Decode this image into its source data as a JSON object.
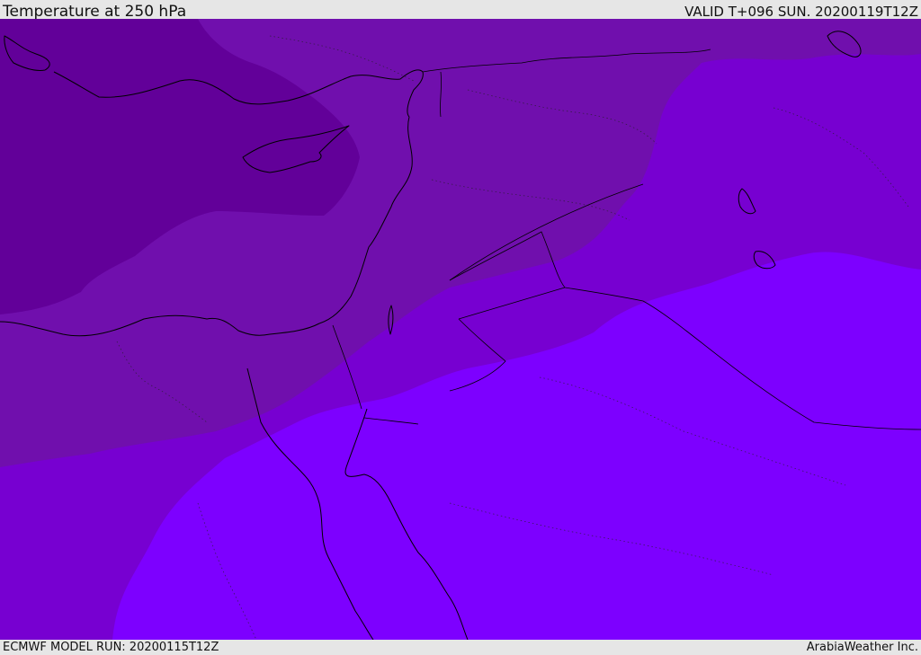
{
  "header": {
    "title": "Temperature at 250 hPa",
    "valid": "VALID T+096 SUN. 20200119T12Z"
  },
  "footer": {
    "model_run": "ECMWF MODEL RUN: 20200115T12Z",
    "credit": "ArabiaWeather Inc."
  },
  "map": {
    "field": "temperature-250hPa",
    "shading_colors": [
      "#620099",
      "#700fad",
      "#7700d1",
      "#7d00ff"
    ],
    "coastline_color": "#000000"
  }
}
